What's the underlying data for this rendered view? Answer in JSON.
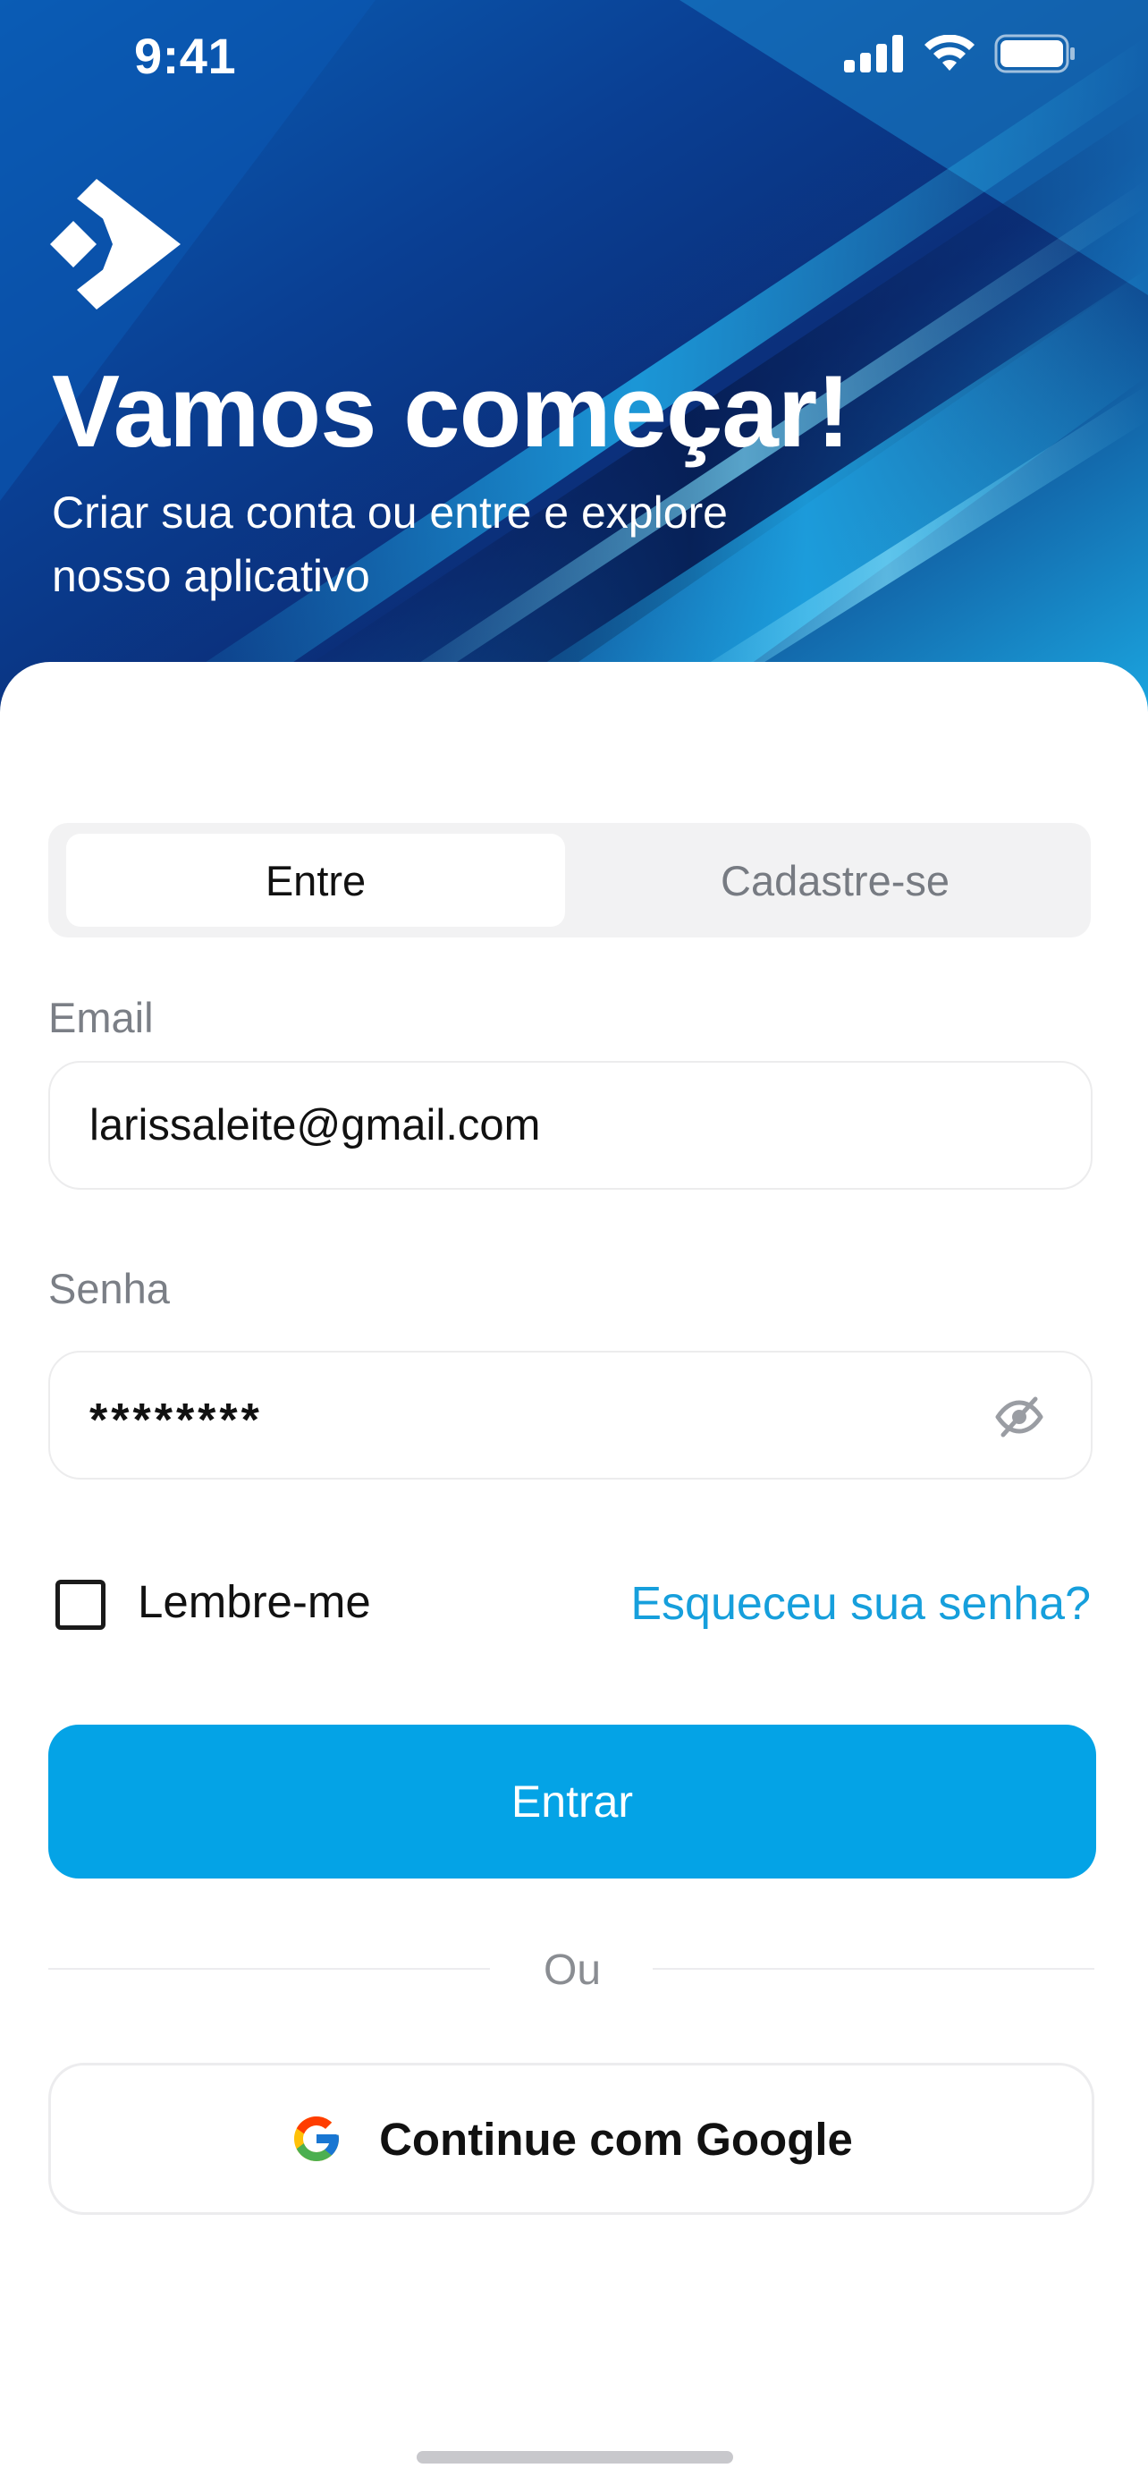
{
  "status_bar": {
    "time": "9:41"
  },
  "hero": {
    "title": "Vamos começar!",
    "subtitle": "Criar sua conta ou entre e explore nosso aplicativo",
    "logo_icon": "chevron-diamond-logo"
  },
  "auth_tabs": {
    "active": "Entre",
    "inactive": "Cadastre-se"
  },
  "email": {
    "label": "Email",
    "value": "larissaleite@gmail.com"
  },
  "password": {
    "label": "Senha",
    "value": "********",
    "toggle_icon": "eye-off-icon"
  },
  "options": {
    "remember_label": "Lembre-me",
    "remember_checked": false,
    "forgot_label": "Esqueceu sua senha?"
  },
  "actions": {
    "submit_label": "Entrar",
    "divider_label": "Ou",
    "google_label": "Continue com Google"
  },
  "colors": {
    "primary": "#04a3e6",
    "link": "#169fdc",
    "hero_dark": "#0b3f8f",
    "hero_light": "#1ba6e0"
  }
}
